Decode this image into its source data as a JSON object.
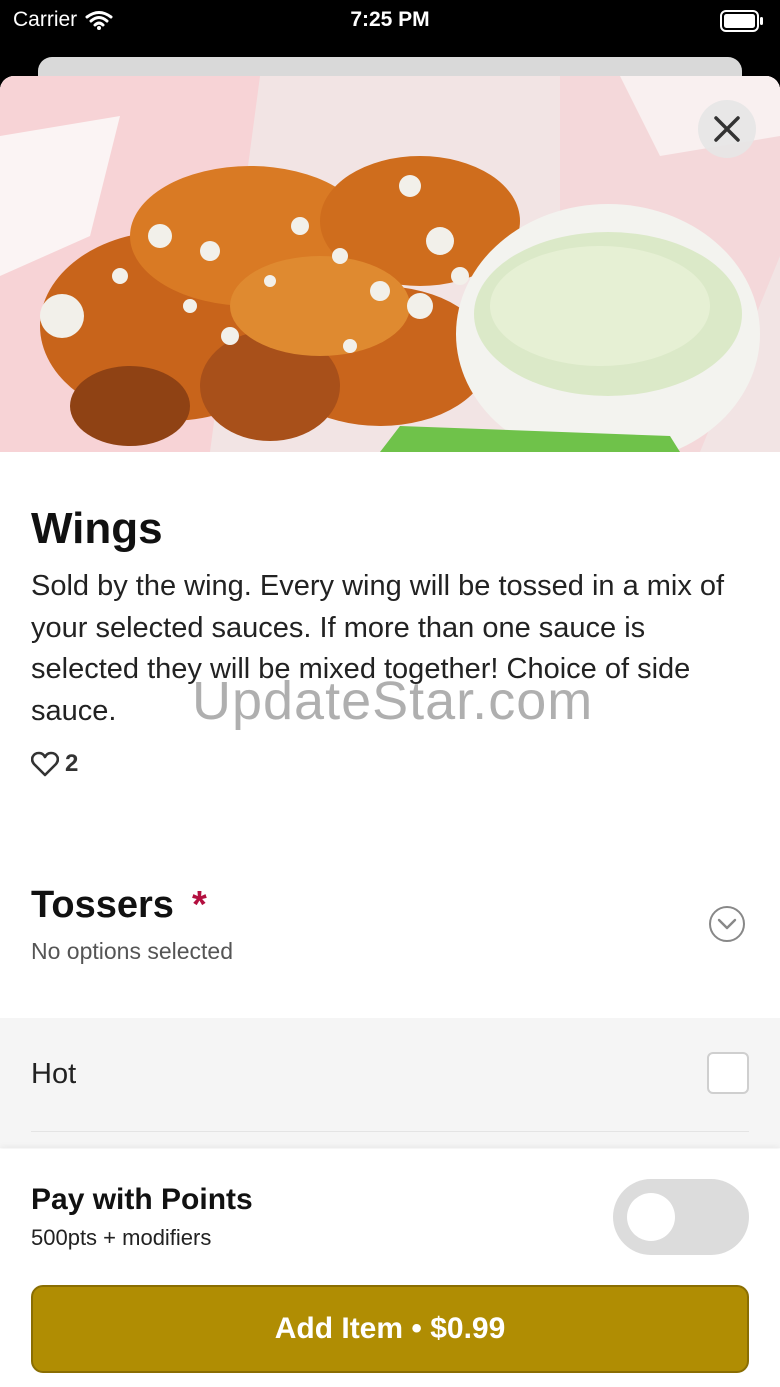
{
  "status_bar": {
    "carrier": "Carrier",
    "time": "7:25 PM"
  },
  "item": {
    "title": "Wings",
    "description": "Sold by the wing. Every wing will be tossed in a mix of your selected sauces. If more than one sauce is selected they will be mixed together! Choice of side sauce.",
    "likes": "2"
  },
  "watermark": "UpdateStar.com",
  "section": {
    "title": "Tossers",
    "required_mark": "*",
    "subtitle": "No options selected"
  },
  "options": [
    {
      "label": "Hot",
      "checked": false
    }
  ],
  "pay_with_points": {
    "title": "Pay with Points",
    "subtitle": "500pts + modifiers",
    "enabled": false
  },
  "add_button": {
    "label": "Add Item • $0.99"
  },
  "colors": {
    "accent": "#b08d03",
    "required": "#b30f3f"
  },
  "icons": [
    "wifi-icon",
    "battery-icon",
    "close-icon",
    "heart-icon",
    "chevron-down-icon"
  ]
}
